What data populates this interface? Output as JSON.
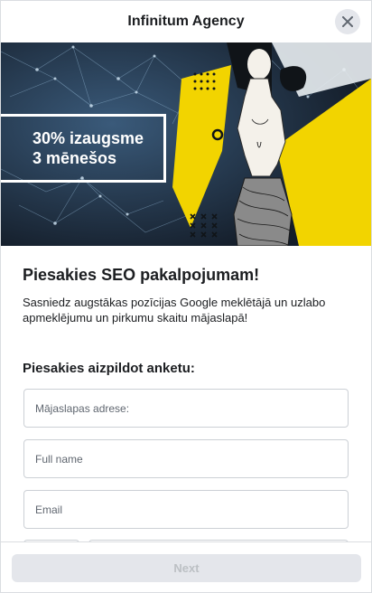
{
  "header": {
    "title": "Infinitum Agency",
    "close_icon": "close-icon"
  },
  "hero": {
    "line1": "30% izaugsme",
    "line2": "3 mēnešos",
    "colors": {
      "background": "#1e2a3a",
      "accent": "#f2d400"
    }
  },
  "form": {
    "title": "Piesakies SEO pakalpojumam!",
    "description": "Sasniedz augstākas pozīcijas Google meklētājā un uzlabo apmeklējumu un pirkumu skaitu mājaslapā!",
    "section_title": "Piesakies aizpildot anketu:",
    "fields": [
      {
        "placeholder": "Mājaslapas adrese:",
        "value": ""
      },
      {
        "placeholder": "Full name",
        "value": ""
      },
      {
        "placeholder": "Email",
        "value": ""
      }
    ]
  },
  "footer": {
    "next_label": "Next"
  }
}
